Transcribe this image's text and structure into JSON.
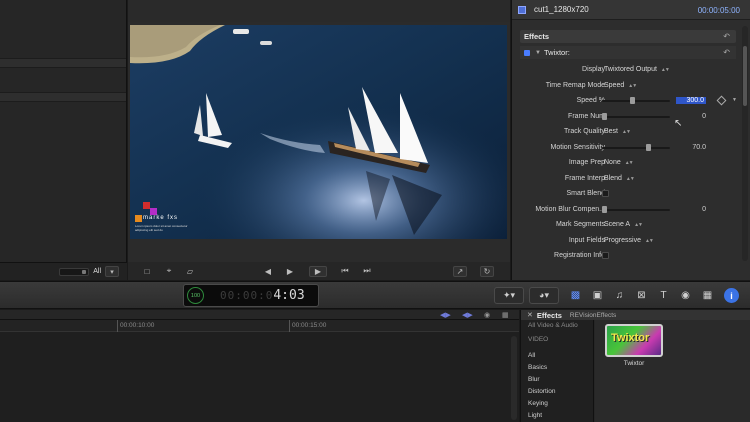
{
  "left_panel": {
    "clip_filter": "All",
    "filter_icon": "triangle-down-icon"
  },
  "viewer": {
    "watermark_brand": "marke fxs",
    "watermark_sub": "Lorem ipsum dolor sit amet consectetur adipiscing elit sed do",
    "controls": {
      "transform": "transform-icon",
      "crop": "crop-icon",
      "distort": "distort-icon",
      "prev_frame": "prev-frame-icon",
      "next_frame": "next-frame-icon",
      "play": "play-icon",
      "go_start": "go-start-icon",
      "go_end": "go-end-icon",
      "fullscreen": "fullscreen-icon",
      "loop": "loop-icon"
    }
  },
  "inspector": {
    "clip_name": "cut1_1280x720",
    "timecode": "00:00:05:00",
    "section_title": "Effects",
    "effect_name": "Twixtor:",
    "params": [
      {
        "label": "Display",
        "type": "popup",
        "value": "Twixtored Output"
      },
      {
        "label": "Time Remap Mode",
        "type": "popup",
        "value": "Speed"
      },
      {
        "label": "Speed %",
        "type": "slider",
        "value": "300.0",
        "fraction": 0.45,
        "selected": true
      },
      {
        "label": "Frame Num",
        "type": "slider",
        "value": "0",
        "fraction": 0.0
      },
      {
        "label": "Track Quality",
        "type": "popup",
        "value": "Best"
      },
      {
        "label": "Motion Sensitivity",
        "type": "slider",
        "value": "70.0",
        "fraction": 0.7
      },
      {
        "label": "Image Prep",
        "type": "popup",
        "value": "None"
      },
      {
        "label": "Frame Interp",
        "type": "popup",
        "value": "Blend"
      },
      {
        "label": "Smart Blend",
        "type": "checkbox",
        "value": ""
      },
      {
        "label": "Motion Blur Compen...",
        "type": "slider",
        "value": "0",
        "fraction": 0.0
      },
      {
        "label": "Mark Segments",
        "type": "popup",
        "value": "Scene A"
      },
      {
        "label": "Input Fields",
        "type": "popup",
        "value": "Progressive"
      },
      {
        "label": "Registration Info",
        "type": "checkbox",
        "value": ""
      }
    ]
  },
  "toolbar": {
    "timecode_percent": "100",
    "timecode_dim": "00:00:0",
    "timecode_bright": "4:03",
    "tool_icon": "select-tool-icon",
    "retime_icon": "retime-icon",
    "browser_icons": [
      "effects-browser-icon",
      "photos-icon",
      "music-icon",
      "transitions-icon",
      "titles-icon",
      "generators-icon",
      "themes-icon"
    ],
    "info": "i"
  },
  "timeline": {
    "ruler_labels": [
      "00:00:10:00",
      "00:00:15:00"
    ]
  },
  "effects_browser": {
    "title": "Effects",
    "subtitle": "REVisionEffects",
    "categories": [
      "All Video & Audio",
      "VIDEO",
      "All",
      "Basics",
      "Blur",
      "Distortion",
      "Keying",
      "Light"
    ],
    "items": [
      {
        "name": "Twixtor",
        "thumb_text": "Twixtor"
      }
    ]
  },
  "colors": {
    "accent_blue": "#3b73e6",
    "selection_blue": "#2f56c9",
    "timecode_green": "#58c467",
    "twixtor_yellow": "#f3e94a"
  }
}
